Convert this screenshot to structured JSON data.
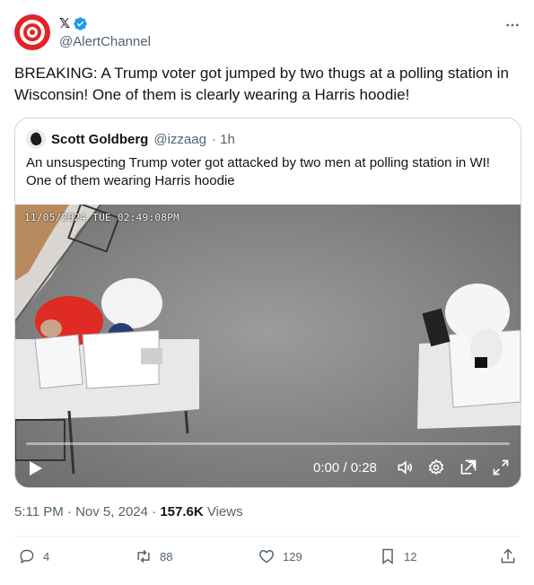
{
  "post": {
    "author": {
      "display_name": "𝕏",
      "handle": "@AlertChannel",
      "verified": true,
      "avatar_icon": "target-logo-icon"
    },
    "text": "BREAKING: A Trump voter got jumped by two thugs at a polling station in Wisconsin! One of them is clearly wearing a Harris hoodie!",
    "timestamp": "5:11 PM · Nov 5, 2024 ·",
    "views_count": "157.6K",
    "views_label": "Views"
  },
  "quote": {
    "author_name": "Scott Goldberg",
    "author_handle": "@izzaag",
    "time_ago": "· 1h",
    "text": "An unsuspecting Trump voter got attacked by two men at polling station in WI! One of them wearing Harris hoodie",
    "video": {
      "overlay_timestamp": "11/05/2024 TUE 02:49:08PM",
      "time_display": "0:00 / 0:28",
      "progress_fraction": 0
    }
  },
  "actions": {
    "replies": "4",
    "reposts": "88",
    "likes": "129",
    "bookmarks": "12"
  },
  "colors": {
    "brand_red": "#e0242a",
    "verified_blue": "#1d9bf0",
    "muted": "#536471"
  }
}
